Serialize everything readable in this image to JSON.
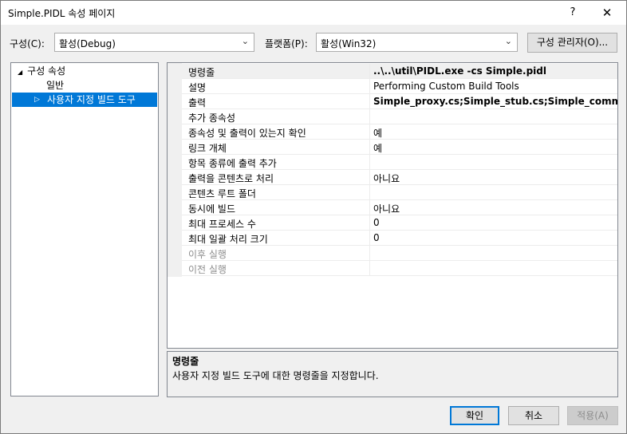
{
  "window": {
    "title": "Simple.PIDL 속성 페이지",
    "help": "?",
    "close": "✕"
  },
  "config": {
    "label": "구성(C):",
    "value": "활성(Debug)"
  },
  "platform": {
    "label": "플랫폼(P):",
    "value": "활성(Win32)"
  },
  "config_manager": "구성 관리자(O)...",
  "tree": {
    "root": {
      "arrow": "◢",
      "label": "구성 속성"
    },
    "general": "일반",
    "custom": {
      "arrow": "▷",
      "label": "사용자 지정 빌드 도구"
    }
  },
  "properties": [
    {
      "name": "명령줄",
      "value": "..\\..\\util\\PIDL.exe -cs Simple.pidl",
      "bold": true,
      "dim": false
    },
    {
      "name": "설명",
      "value": "Performing Custom Build Tools",
      "bold": false,
      "dim": false
    },
    {
      "name": "출력",
      "value": "Simple_proxy.cs;Simple_stub.cs;Simple_common.cs",
      "bold": true,
      "dim": false
    },
    {
      "name": "추가 종속성",
      "value": "",
      "bold": false,
      "dim": false
    },
    {
      "name": "종속성 및 출력이 있는지 확인",
      "value": "예",
      "bold": false,
      "dim": false
    },
    {
      "name": "링크 개체",
      "value": "예",
      "bold": false,
      "dim": false
    },
    {
      "name": "항목 종류에 출력 추가",
      "value": "",
      "bold": false,
      "dim": false
    },
    {
      "name": "출력을 콘텐츠로 처리",
      "value": "아니요",
      "bold": false,
      "dim": false
    },
    {
      "name": "콘텐츠 루트 폴더",
      "value": "",
      "bold": false,
      "dim": false
    },
    {
      "name": "동시에 빌드",
      "value": "아니요",
      "bold": false,
      "dim": false
    },
    {
      "name": "최대 프로세스 수",
      "value": "0",
      "bold": false,
      "dim": false
    },
    {
      "name": "최대 일괄 처리 크기",
      "value": "0",
      "bold": false,
      "dim": false
    },
    {
      "name": "이후 실행",
      "value": "",
      "bold": false,
      "dim": true
    },
    {
      "name": "이전 실행",
      "value": "",
      "bold": false,
      "dim": true
    }
  ],
  "description": {
    "title": "명령줄",
    "text": "사용자 지정 빌드 도구에 대한 명령줄을 지정합니다."
  },
  "buttons": {
    "ok": "확인",
    "cancel": "취소",
    "apply": "적용(A)"
  }
}
